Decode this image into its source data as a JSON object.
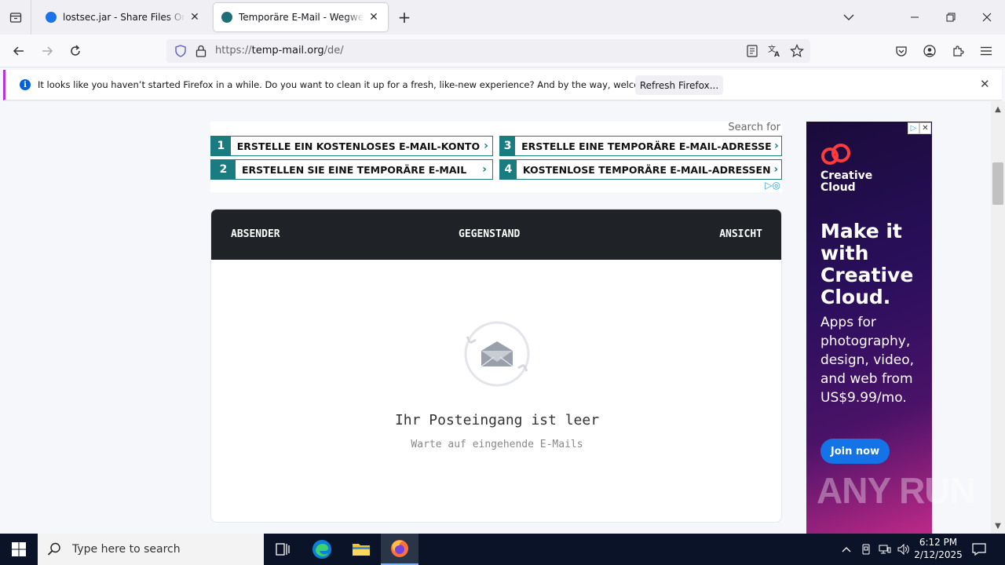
{
  "browser": {
    "tabs": [
      {
        "title": "lostsec.jar - Share Files Online &",
        "favicon_color": "#1a73e8",
        "active": false
      },
      {
        "title": "Temporäre E-Mail - Wegwerf Ei",
        "favicon_color": "#1f6f78",
        "active": true
      }
    ],
    "url_prefix": "https://",
    "url_domain": "temp-mail.org",
    "url_path": "/de/"
  },
  "notification": {
    "message": "It looks like you haven’t started Firefox in a while. Do you want to clean it up for a fresh, like-new experience? And by the way, welcome back!",
    "button": "Refresh Firefox..."
  },
  "ads": {
    "search_for": "Search for",
    "links": [
      {
        "num": "1",
        "text": "ERSTELLE EIN KOSTENLOSES E-MAIL-KONTO"
      },
      {
        "num": "2",
        "text": "ERSTELLEN SIE EINE TEMPORÄRE E-MAIL"
      },
      {
        "num": "3",
        "text": "ERSTELLE EINE TEMPORÄRE E-MAIL-ADRESSE"
      },
      {
        "num": "4",
        "text": "KOSTENLOSE TEMPORÄRE E-MAIL-ADRESSEN"
      }
    ]
  },
  "inbox": {
    "col_sender": "ABSENDER",
    "col_subject": "GEGENSTAND",
    "col_view": "ANSICHT",
    "empty_title": "Ihr Posteingang ist leer",
    "empty_subtitle": "Warte auf eingehende E-Mails"
  },
  "side_ad": {
    "brand_line1": "Creative",
    "brand_line2": "Cloud",
    "headline1": "Make it",
    "headline2": "with",
    "headline3": "Creative",
    "headline4": "Cloud.",
    "body1": "Apps for",
    "body2": "photography,",
    "body3": "design, video,",
    "body4": "and web from",
    "price": "US$9.99/mo.",
    "cta": "Join now"
  },
  "watermark": "ANY RUN",
  "taskbar": {
    "search_placeholder": "Type here to search",
    "time": "6:12 PM",
    "date": "2/12/2025"
  },
  "colors": {
    "accent_teal": "#1a7b80",
    "header_dark": "#1f2227",
    "firefox_blue": "#0060df"
  }
}
